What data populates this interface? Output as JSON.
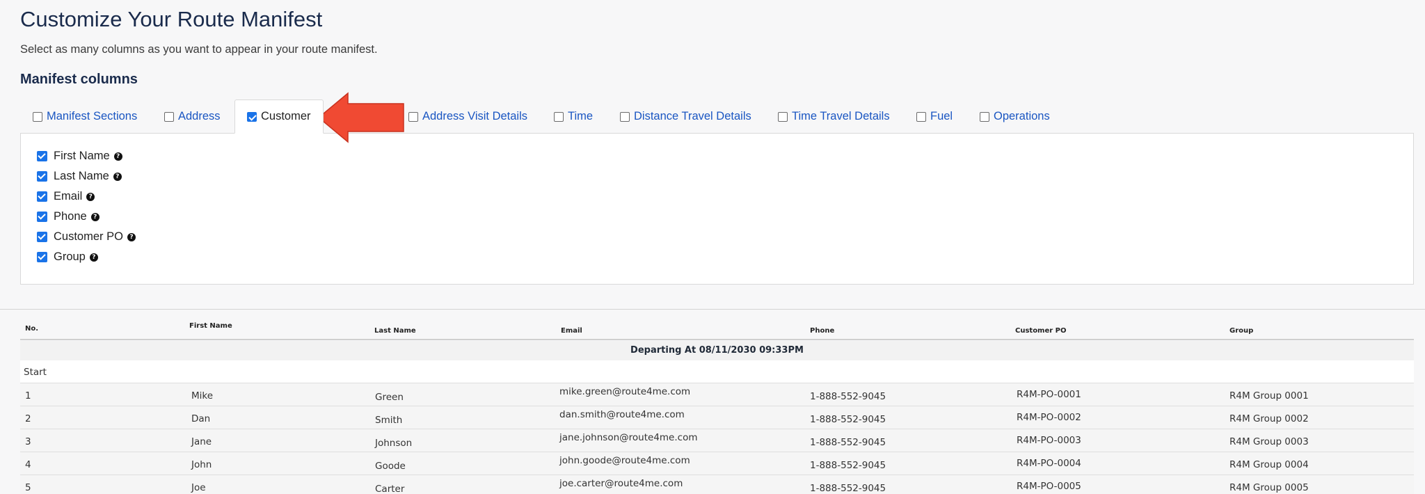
{
  "page": {
    "title": "Customize Your Route Manifest",
    "subtitle": "Select as many columns as you want to appear in your route manifest.",
    "section_title": "Manifest columns"
  },
  "tabs": [
    {
      "label": "Manifest Sections",
      "checked": false
    },
    {
      "label": "Address",
      "checked": false
    },
    {
      "label": "Customer",
      "checked": true
    },
    {
      "label": "Address Visit Details",
      "checked": false
    },
    {
      "label": "Time",
      "checked": false
    },
    {
      "label": "Distance Travel Details",
      "checked": false
    },
    {
      "label": "Time Travel Details",
      "checked": false
    },
    {
      "label": "Fuel",
      "checked": false
    },
    {
      "label": "Operations",
      "checked": false
    }
  ],
  "options": [
    {
      "label": "First Name",
      "checked": true
    },
    {
      "label": "Last Name",
      "checked": true
    },
    {
      "label": "Email",
      "checked": true
    },
    {
      "label": "Phone",
      "checked": true
    },
    {
      "label": "Customer PO",
      "checked": true
    },
    {
      "label": "Group",
      "checked": true
    }
  ],
  "help_icon_glyph": "?",
  "accent_color": "#1a73e8",
  "arrow_color": "#f04a33",
  "table": {
    "headers": [
      "No.",
      "First Name",
      "Last Name",
      "Email",
      "Phone",
      "Customer PO",
      "Group"
    ],
    "departing": "Departing At 08/11/2030 09:33PM",
    "start_label": "Start",
    "rows": [
      [
        "1",
        "Mike",
        "Green",
        "mike.green@route4me.com",
        "1-888-552-9045",
        "R4M-PO-0001",
        "R4M Group 0001"
      ],
      [
        "2",
        "Dan",
        "Smith",
        "dan.smith@route4me.com",
        "1-888-552-9045",
        "R4M-PO-0002",
        "R4M Group 0002"
      ],
      [
        "3",
        "Jane",
        "Johnson",
        "jane.johnson@route4me.com",
        "1-888-552-9045",
        "R4M-PO-0003",
        "R4M Group 0003"
      ],
      [
        "4",
        "John",
        "Goode",
        "john.goode@route4me.com",
        "1-888-552-9045",
        "R4M-PO-0004",
        "R4M Group 0004"
      ],
      [
        "5",
        "Joe",
        "Carter",
        "joe.carter@route4me.com",
        "1-888-552-9045",
        "R4M-PO-0005",
        "R4M Group 0005"
      ]
    ]
  }
}
